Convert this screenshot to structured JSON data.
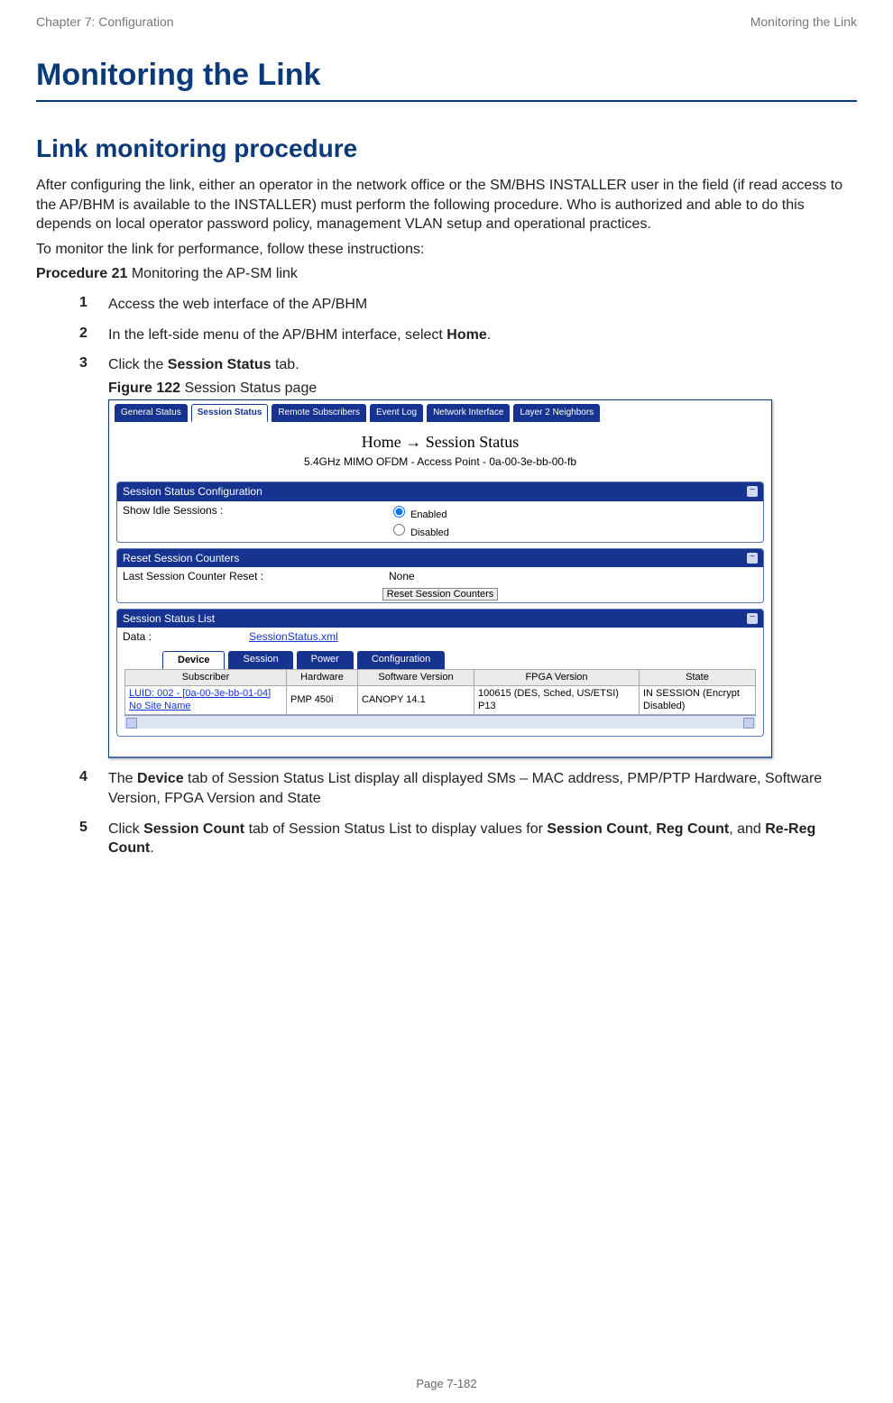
{
  "header": {
    "chapter": "Chapter 7:  Configuration",
    "right": "Monitoring the Link"
  },
  "title": "Monitoring the Link",
  "section": "Link monitoring procedure",
  "para1": "After configuring the link, either an operator in the network office or the SM/BHS INSTALLER user in the field (if read access to the AP/BHM is available to the INSTALLER) must perform the following procedure. Who is authorized and able to do this depends on local operator password policy, management VLAN setup and operational practices.",
  "para2": "To monitor the link for performance, follow these instructions:",
  "procedure_line": {
    "label": "Procedure 21",
    "text": " Monitoring the AP-SM link"
  },
  "steps": {
    "n1": "1",
    "t1": "Access the web interface of the AP/BHM",
    "n2": "2",
    "t2_pre": "In the left-side menu of the AP/BHM interface, select ",
    "t2_bold": "Home",
    "t2_post": ".",
    "n3": "3",
    "t3_pre": "Click the ",
    "t3_bold": "Session Status",
    "t3_post": " tab.",
    "fig_label": "Figure 122",
    "fig_text": " Session Status page",
    "n4": "4",
    "t4_pre": "The ",
    "t4_bold": "Device",
    "t4_post": " tab of Session Status List display all displayed SMs – MAC address, PMP/PTP Hardware, Software Version, FPGA Version and State",
    "n5": "5",
    "t5_pre": "Click ",
    "t5_b1": "Session Count",
    "t5_mid1": " tab of Session Status List to display values for ",
    "t5_b2": "Session Count",
    "t5_mid2": ", ",
    "t5_b3": "Reg Count",
    "t5_mid3": ", and ",
    "t5_b4": "Re-Reg Count",
    "t5_post": "."
  },
  "shot": {
    "page_tabs": {
      "t0": "General Status",
      "t1": "Session Status",
      "t2": "Remote Subscribers",
      "t3": "Event Log",
      "t4": "Network Interface",
      "t5": "Layer 2 Neighbors"
    },
    "breadcrumb": "Home → Session Status",
    "subinfo": "5.4GHz MIMO OFDM - Access Point - 0a-00-3e-bb-00-fb",
    "panels": {
      "cfg": {
        "title": "Session Status Configuration",
        "label": "Show Idle Sessions :",
        "opt_enabled": "Enabled",
        "opt_disabled": "Disabled"
      },
      "reset": {
        "title": "Reset Session Counters",
        "label": "Last Session Counter Reset :",
        "value": "None",
        "button": "Reset Session Counters"
      },
      "list": {
        "title": "Session Status List",
        "data_label": "Data :",
        "xml": "SessionStatus.xml",
        "inner_tabs": {
          "a": "Device",
          "b": "Session",
          "c": "Power",
          "d": "Configuration"
        },
        "cols": {
          "subscriber": "Subscriber",
          "hardware": "Hardware",
          "software": "Software Version",
          "fpga": "FPGA Version",
          "state": "State"
        },
        "row": {
          "sub_line1": "LUID: 002 - [0a-00-3e-bb-01-04]",
          "sub_line2": "No Site Name",
          "hardware": "PMP 450i",
          "software": "CANOPY 14.1",
          "fpga": "100615 (DES, Sched, US/ETSI) P13",
          "state": "IN SESSION (Encrypt Disabled)"
        }
      }
    }
  },
  "page_number": "Page 7-182"
}
